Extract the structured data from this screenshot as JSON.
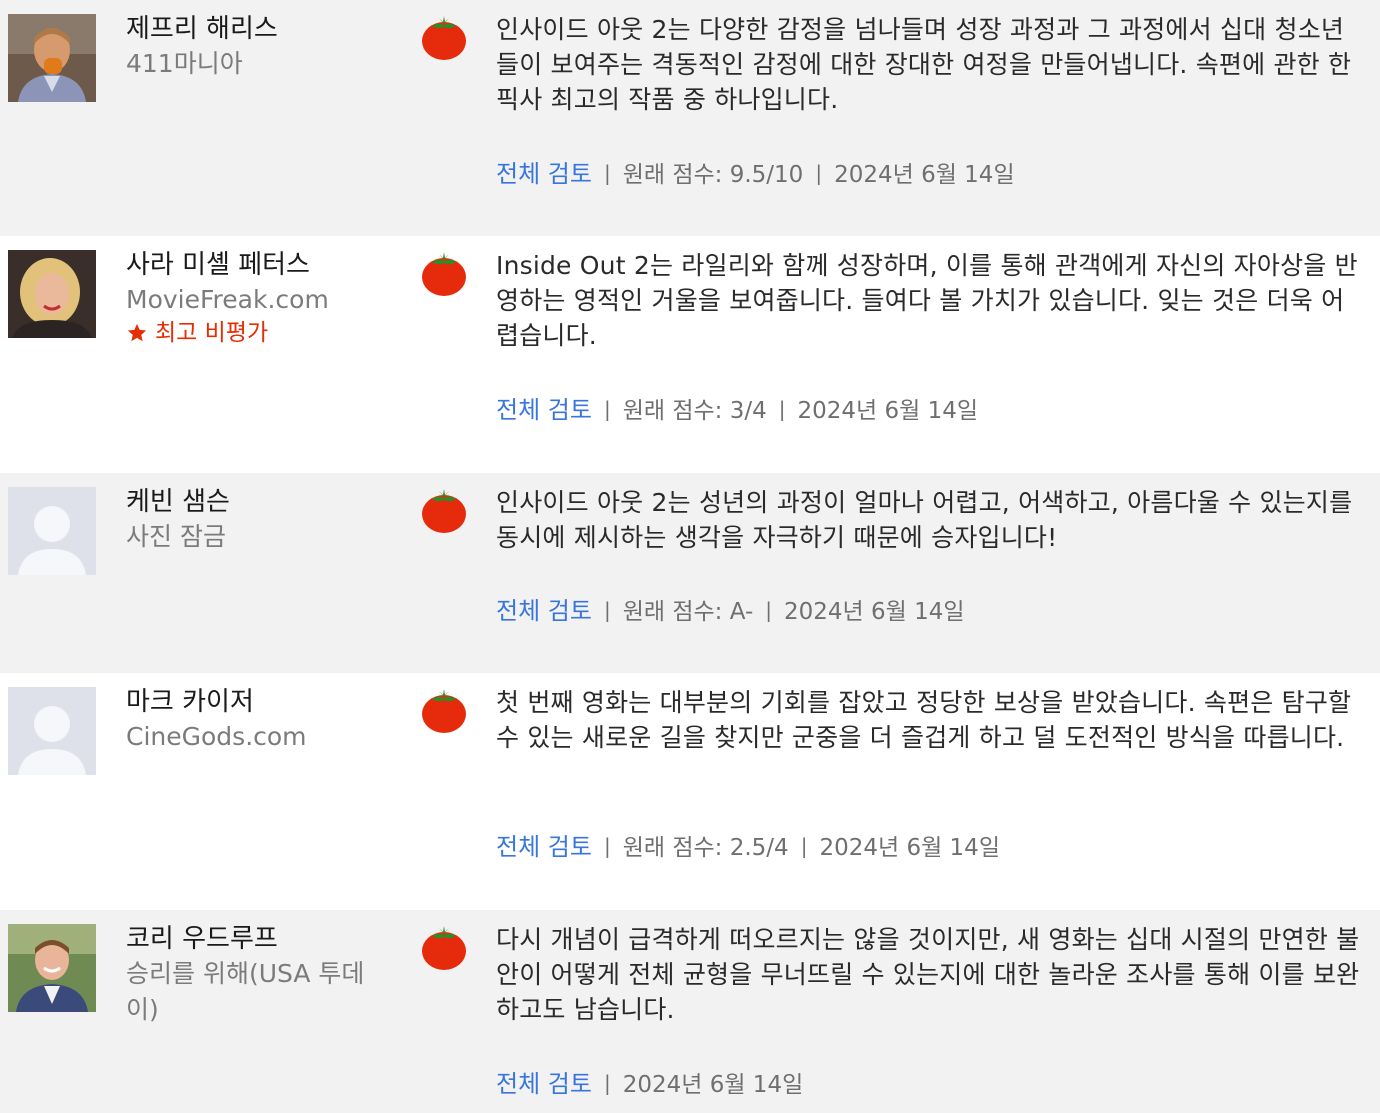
{
  "colors": {
    "row_shaded": "#f2f2f2",
    "link": "#3976dc",
    "top_critic": "#e62e05",
    "tomato_red": "#e52b0c",
    "tomato_leaf": "#2d8d28"
  },
  "reviews": [
    {
      "critic": "제프리 해리스",
      "publication": "411마니아",
      "top_critic": "",
      "avatar": "photo-avatar",
      "rating_icon": "fresh-tomato-icon",
      "quote": "인사이드 아웃 2는 다양한 감정을 넘나들며 성장 과정과 그 과정에서 십대 청소년들이 보여주는 격동적인 감정에 대한 장대한 여정을 만들어냅니다. 속편에 관한 한 픽사 최고의 작품 중 하나입니다.",
      "full_review": "전체 검토",
      "score": "원래 점수: 9.5/10",
      "date": "2024년 6월 14일"
    },
    {
      "critic": "사라 미셸 페터스",
      "publication": "MovieFreak.com",
      "top_critic": "최고 비평가",
      "avatar": "photo-avatar",
      "rating_icon": "fresh-tomato-icon",
      "quote": "Inside Out 2는 라일리와 함께 성장하며, 이를 통해 관객에게 자신의 자아상을 반영하는 영적인 거울을 보여줍니다. 들여다 볼 가치가 있습니다. 잊는 것은 더욱 어렵습니다.",
      "full_review": "전체 검토",
      "score": "원래 점수: 3/4",
      "date": "2024년 6월 14일"
    },
    {
      "critic": "케빈 샘슨",
      "publication": "사진 잠금",
      "top_critic": "",
      "avatar": "placeholder-avatar",
      "rating_icon": "fresh-tomato-icon",
      "quote": "인사이드 아웃 2는 성년의 과정이 얼마나 어렵고, 어색하고, 아름다울 수 있는지를 동시에 제시하는 생각을 자극하기 때문에 승자입니다!",
      "full_review": "전체 검토",
      "score": "원래 점수: A-",
      "date": "2024년 6월 14일"
    },
    {
      "critic": "마크 카이저",
      "publication": "CineGods.com",
      "top_critic": "",
      "avatar": "placeholder-avatar",
      "rating_icon": "fresh-tomato-icon",
      "quote": "첫 번째 영화는 대부분의 기회를 잡았고 정당한 보상을 받았습니다. 속편은 탐구할 수 있는 새로운 길을 찾지만 군중을 더 즐겁게 하고 덜 도전적인 방식을 따릅니다.",
      "full_review": "전체 검토",
      "score": "원래 점수: 2.5/4",
      "date": "2024년 6월 14일"
    },
    {
      "critic": "코리 우드루프",
      "publication": "승리를 위해(USA 투데이)",
      "top_critic": "",
      "avatar": "photo-avatar",
      "rating_icon": "fresh-tomato-icon",
      "quote": "다시 개념이 급격하게 떠오르지는 않을 것이지만, 새 영화는 십대 시절의 만연한 불안이 어떻게 전체 균형을 무너뜨릴 수 있는지에 대한 놀라운 조사를 통해 이를 보완하고도 남습니다.",
      "full_review": "전체 검토",
      "score": "",
      "date": "2024년 6월 14일"
    }
  ]
}
